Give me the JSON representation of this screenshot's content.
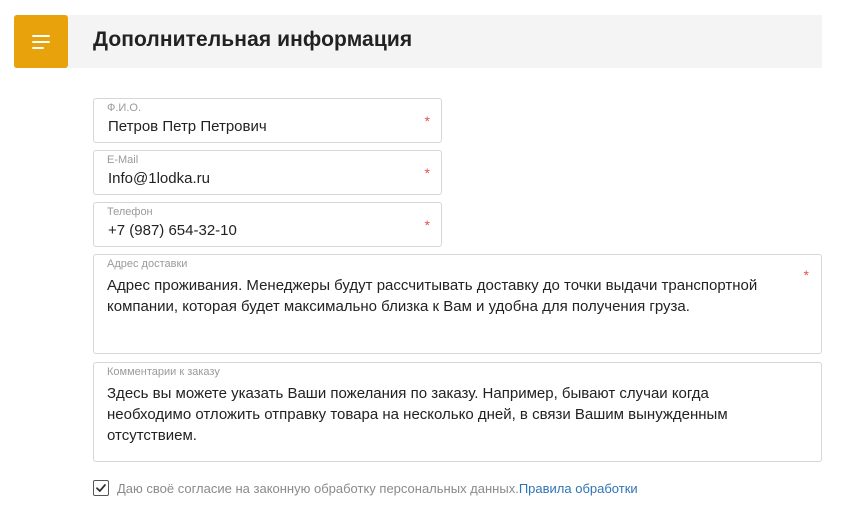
{
  "header": {
    "title": "Дополнительная информация",
    "menu_icon": "hamburger-menu-icon",
    "accent_color": "#e8a20c"
  },
  "form": {
    "fio": {
      "label": "Ф.И.О.",
      "value": "Петров Петр Петрович",
      "required_mark": "*"
    },
    "email": {
      "label": "E-Mail",
      "value": "Info@1lodka.ru",
      "required_mark": "*"
    },
    "phone": {
      "label": "Телефон",
      "value": "+7 (987) 654-32-10",
      "required_mark": "*"
    },
    "address": {
      "label": "Адрес доставки",
      "value": "Адрес проживания. Менеджеры будут рассчитывать доставку до точки выдачи транспортной\nкомпании, которая будет максимально близка к Вам и удобна для получения груза.",
      "required_mark": "*"
    },
    "comment": {
      "label": "Комментарии к заказу",
      "value": "Здесь вы можете указать Ваши пожелания по заказу. Например, бывают случаи когда\nнеобходимо отложить отправку товара на несколько дней, в связи Вашим вынужденным\nотсутствием."
    }
  },
  "consent": {
    "checked": true,
    "text": "Даю своё согласие на законную обработку персональных данных.",
    "link_text": "Правила обработки"
  },
  "colors": {
    "required": "#e4544b",
    "link": "#2f74b5",
    "header_bg": "#f4f4f4"
  }
}
